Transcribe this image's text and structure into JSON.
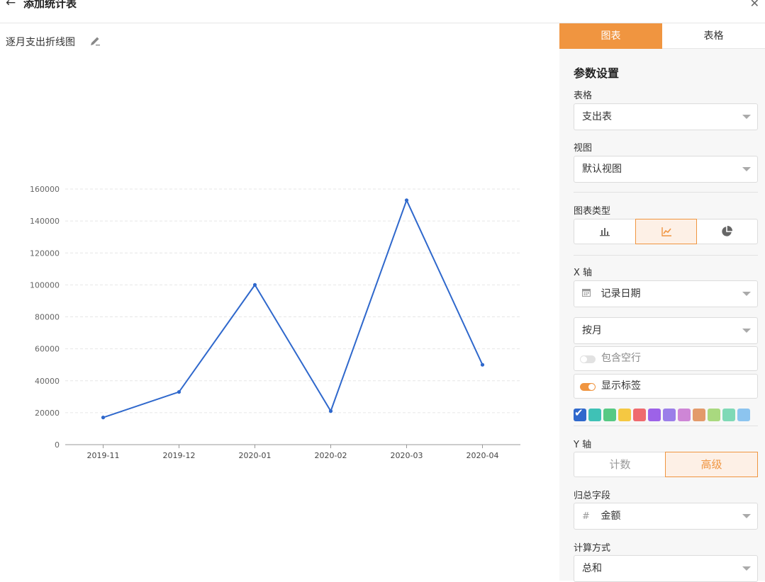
{
  "header": {
    "title": "添加统计表"
  },
  "chart_title": "逐月支出折线图",
  "chart_data": {
    "type": "line",
    "x": [
      "2019-11",
      "2019-12",
      "2020-01",
      "2020-02",
      "2020-03",
      "2020-04"
    ],
    "series": [
      {
        "values": [
          17000,
          33000,
          100000,
          21000,
          153000,
          50000
        ]
      }
    ],
    "yticks": [
      "160000",
      "140000",
      "120000",
      "100000",
      "80000",
      "60000",
      "40000",
      "20000",
      "0"
    ],
    "ylim": [
      0,
      160000
    ],
    "grid": true,
    "color": "#2f68cc"
  },
  "panel": {
    "tabs": [
      {
        "label": "图表"
      },
      {
        "label": "表格"
      }
    ],
    "section_title": "参数设置",
    "table": {
      "label": "表格",
      "value": "支出表"
    },
    "view": {
      "label": "视图",
      "value": "默认视图"
    },
    "chart_type": {
      "label": "图表类型",
      "options": [
        "bar-chart-icon",
        "line-chart-icon",
        "pie-chart-icon"
      ],
      "selected": "line-chart-icon"
    },
    "x_axis": {
      "label": "X 轴",
      "field": "记录日期",
      "field_icon": "calendar-icon",
      "group_by": "按月"
    },
    "include_empty": {
      "label": "包含空行",
      "on": false
    },
    "show_labels": {
      "label": "显示标签",
      "on": true
    },
    "colors": [
      "#2f68cc",
      "#3fc1b6",
      "#56c984",
      "#f5c842",
      "#ef6a6e",
      "#9d62e8",
      "#9b7ee9",
      "#ce86d6",
      "#e39a6a",
      "#a9d97f",
      "#7fd9b6",
      "#8cc4ef"
    ],
    "selected_color": "#2f68cc",
    "y_axis": {
      "label": "Y 轴",
      "options": [
        "计数",
        "高级"
      ],
      "selected": "高级"
    },
    "summary_field": {
      "label": "归总字段",
      "value": "金额",
      "field_icon": "hash-icon"
    },
    "calc_method": {
      "label": "计算方式",
      "value": "总和"
    },
    "accent": "#f09540"
  }
}
